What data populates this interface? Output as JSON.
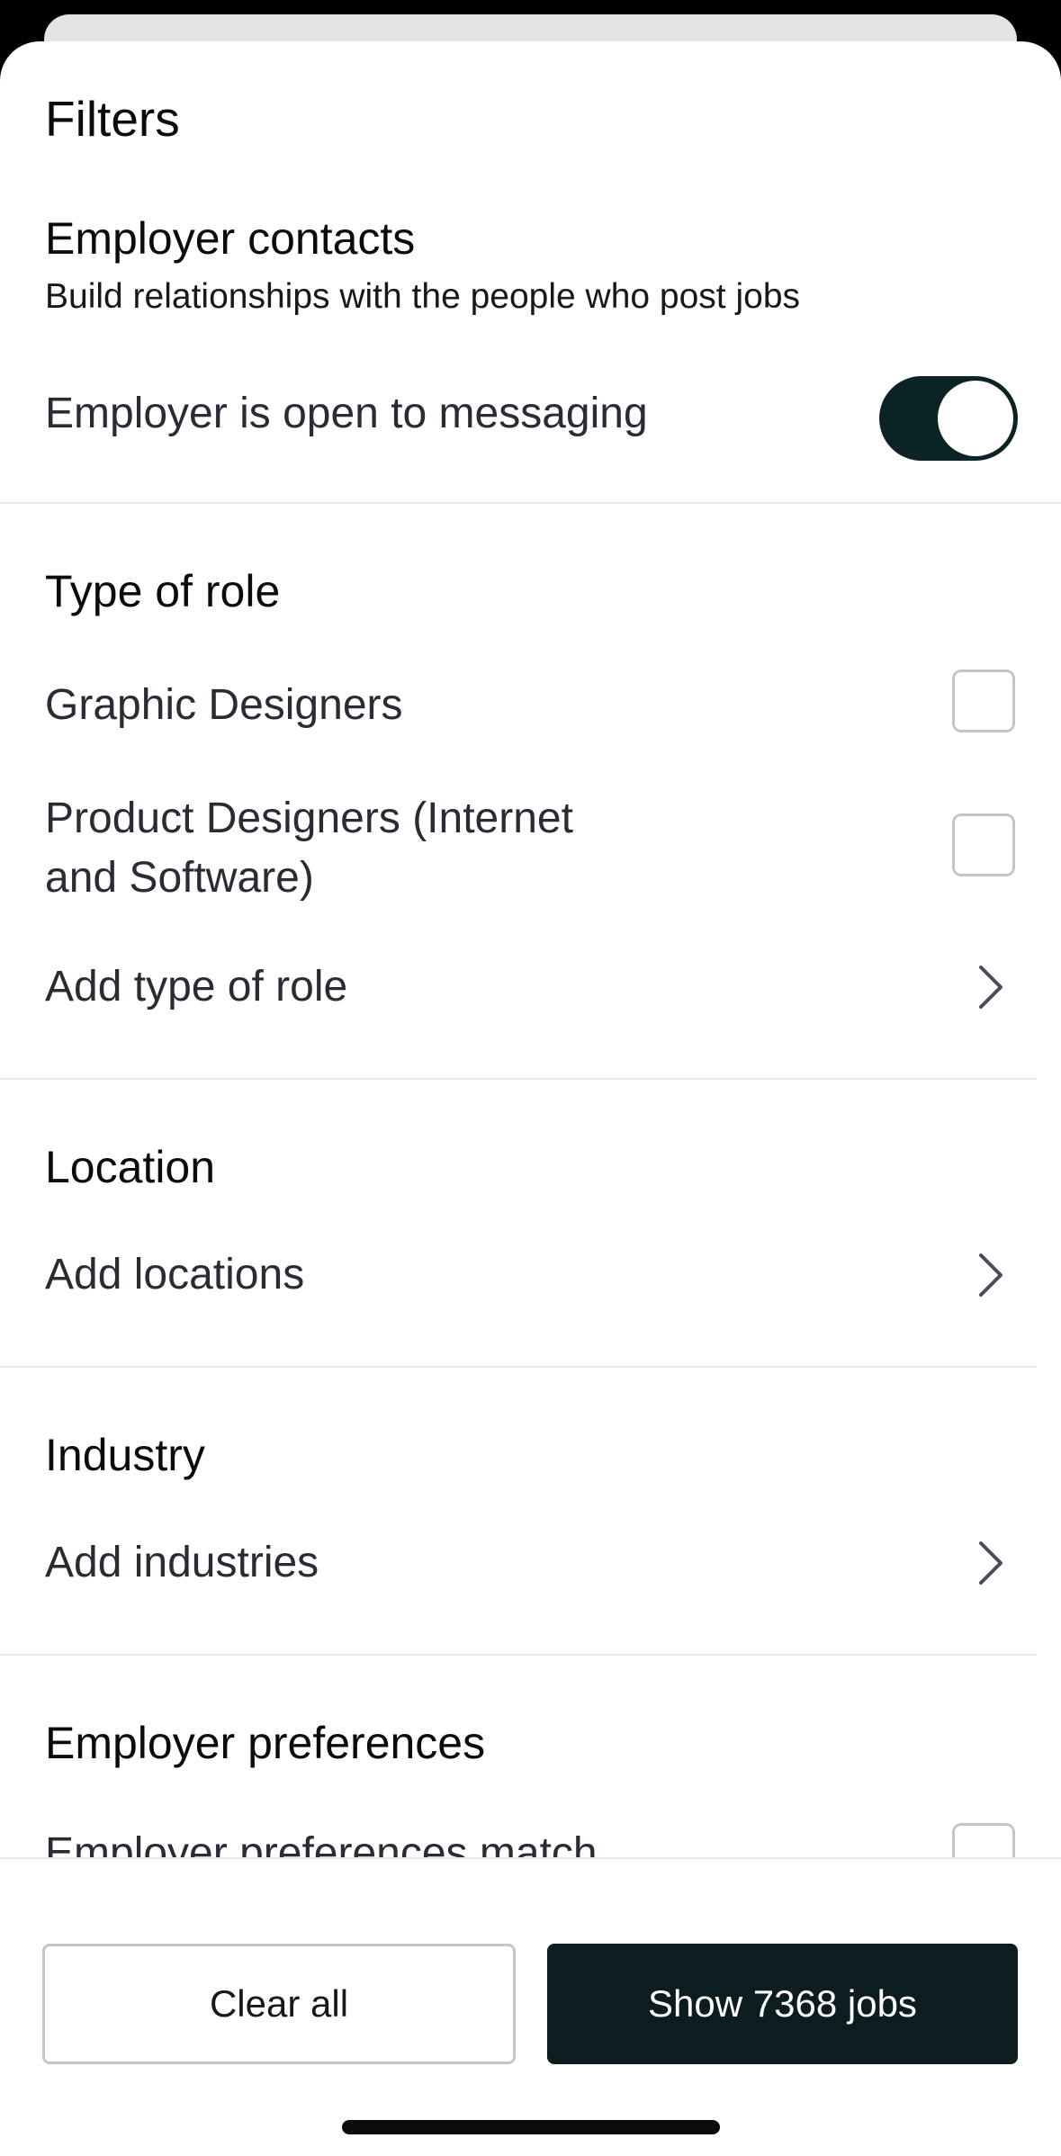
{
  "sheet": {
    "title": "Filters"
  },
  "employer_contacts": {
    "title": "Employer contacts",
    "subtitle": "Build relationships with the people who post jobs",
    "toggle_label": "Employer is open to messaging",
    "toggle_on": true
  },
  "type_of_role": {
    "title": "Type of role",
    "options": [
      {
        "label": "Graphic Designers",
        "checked": false
      },
      {
        "label_line1": "Product Designers (Internet",
        "label_line2": "and Software)",
        "checked": false
      }
    ],
    "add_label": "Add type of role"
  },
  "location": {
    "title": "Location",
    "add_label": "Add locations"
  },
  "industry": {
    "title": "Industry",
    "add_label": "Add industries"
  },
  "employer_preferences": {
    "title": "Employer preferences",
    "option_label": "Employer preferences match"
  },
  "footer": {
    "clear_label": "Clear all",
    "show_label": "Show 7368 jobs"
  },
  "colors": {
    "toggle_on": "#0c2325",
    "primary_button": "#0c1c1f",
    "divider": "#e8e8ec"
  },
  "icons": [
    "chevron-right-icon",
    "checkbox-icon"
  ]
}
